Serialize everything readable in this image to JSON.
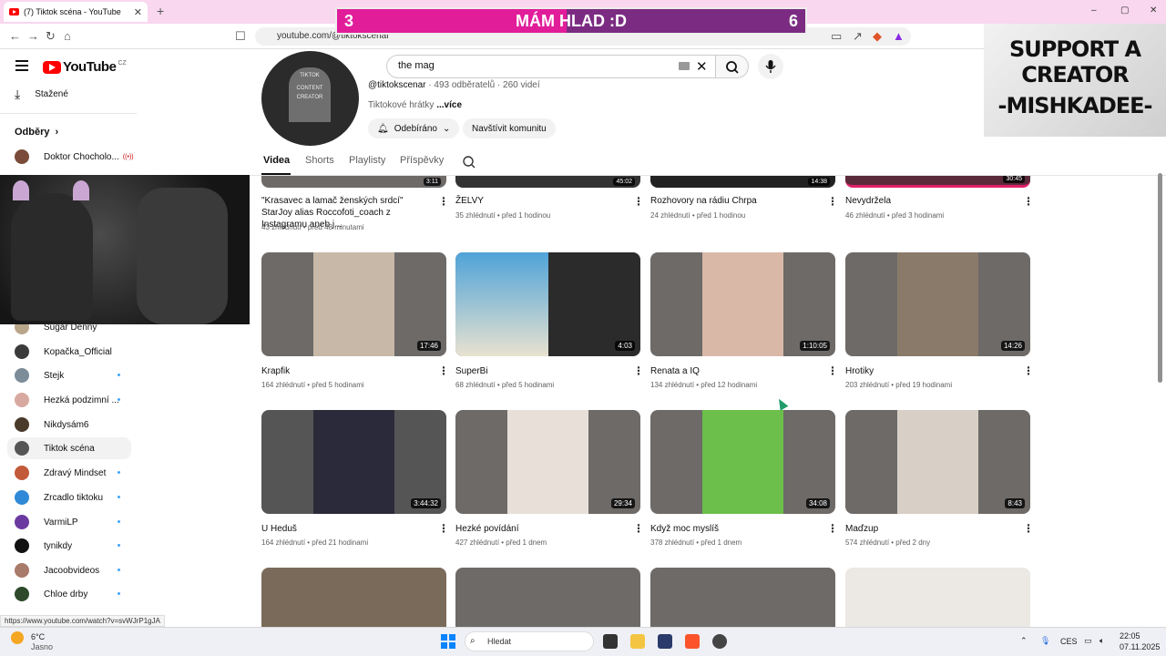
{
  "browser": {
    "tab_title": "(7) Tiktok scéna - YouTube",
    "tab_close": "✕",
    "new_tab": "+",
    "url": "youtube.com/@tiktokscenar",
    "window_controls": [
      "–",
      "▢",
      "✕"
    ]
  },
  "overlay": {
    "score_left": "3",
    "score_text": "MÁM HLAD :D",
    "score_right": "6",
    "score_progress": 0.49,
    "support_line1": "SUPPORT A",
    "support_line2": "CREATOR",
    "support_line3": "-MISHKADEE-"
  },
  "masthead": {
    "logo_text": "YouTube",
    "country": "CZ",
    "search_value": "the mag",
    "clear_icon": "✕"
  },
  "sidebar": {
    "downloads": "Stažené",
    "subscriptions": "Odběry",
    "subscriptions_arrow": "›",
    "channels": [
      {
        "name": "Doktor Chocholo...",
        "live": "((•))"
      },
      {
        "name": "Sugar Denny"
      },
      {
        "name": "Kopačka_Official"
      },
      {
        "name": "Stejk"
      },
      {
        "name": "Hezká podzimní ..."
      },
      {
        "name": "Nikdysám6"
      },
      {
        "name": "Tiktok scéna"
      },
      {
        "name": "Zdravý Mindset"
      },
      {
        "name": "Zrcadlo tiktoku"
      },
      {
        "name": "VarmiLP"
      },
      {
        "name": "tynikdy"
      },
      {
        "name": "Jacoobvideos"
      },
      {
        "name": "Chloe drby"
      }
    ]
  },
  "channel": {
    "avatar_text": [
      "TIKTOK",
      "CONTENT",
      "CREATOR"
    ],
    "handle": "@tiktokscenar",
    "stats": " · 493 odběratelů · 260 videí",
    "desc": "Tiktokové hrátky",
    "more": " ...více",
    "subscribed_label": "Odebíráno",
    "community_label": "Navštívit komunitu",
    "tabs": [
      "Videa",
      "Shorts",
      "Playlisty",
      "Příspěvky"
    ]
  },
  "videos_top": [
    {
      "title": "\"Krasavec a lamač ženských srdcí\" StarJoy alias Roccofoti_coach z Instagramu aneb j...",
      "meta": "43 zhlédnutí • před 48 minutami",
      "dur": "3:11"
    },
    {
      "title": "ŽELVY",
      "meta": "35 zhlédnutí • před 1 hodinou",
      "dur": "45:02"
    },
    {
      "title": "Rozhovory na rádiu Chrpa",
      "meta": "24 zhlédnutí • před 1 hodinou",
      "dur": "14:38"
    },
    {
      "title": "Nevydržela",
      "meta": "46 zhlédnutí • před 3 hodinami",
      "dur": "30:45"
    }
  ],
  "videos_row2": [
    {
      "title": "Krapfik",
      "meta": "164 zhlédnutí • před 5 hodinami",
      "dur": "17:46"
    },
    {
      "title": "SuperBi",
      "meta": "68 zhlédnutí • před 5 hodinami",
      "dur": "4:03"
    },
    {
      "title": "Renata a IQ",
      "meta": "134 zhlédnutí • před 12 hodinami",
      "dur": "1:10:05"
    },
    {
      "title": "Hrotiky",
      "meta": "203 zhlédnutí • před 19 hodinami",
      "dur": "14:26"
    }
  ],
  "videos_row3": [
    {
      "title": "U Heduš",
      "meta": "164 zhlédnutí • před 21 hodinami",
      "dur": "3:44:32"
    },
    {
      "title": "Hezké povídání",
      "meta": "427 zhlédnutí • před 1 dnem",
      "dur": "29:34"
    },
    {
      "title": "Když moc myslíš",
      "meta": "378 zhlédnutí • před 1 dnem",
      "dur": "34:08"
    },
    {
      "title": "Maďzup",
      "meta": "574 zhlédnutí • před 2 dny",
      "dur": "8:43"
    }
  ],
  "status_url": "https://www.youtube.com/watch?v=svWJrP1gJA",
  "taskbar": {
    "weather_temp": "6°C",
    "weather_desc": "Jasno",
    "search": "Hledat",
    "lang": "CES",
    "time": "22:05",
    "date": "07.11.2025"
  },
  "colors": {
    "accent": "#ff0000",
    "overlay_fill": "#e11d9a",
    "overlay_bg": "#7b2c82",
    "tabstrip": "#f8d7ef"
  }
}
